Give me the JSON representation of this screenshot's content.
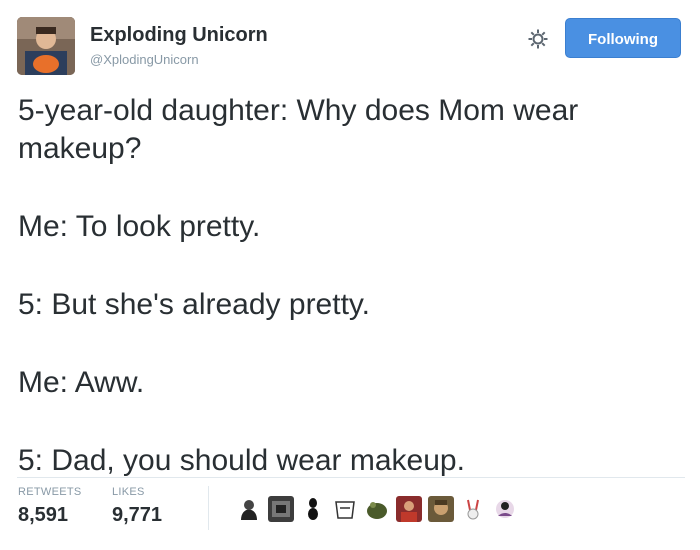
{
  "author": {
    "name": "Exploding Unicorn",
    "handle": "@XplodingUnicorn"
  },
  "icons": {
    "gear": "gear-icon",
    "avatar": "user-avatar"
  },
  "follow_button": {
    "label": "Following",
    "color": "#4a90e2"
  },
  "tweet": {
    "paragraphs": [
      "5-year-old daughter: Why does Mom wear makeup?",
      "Me: To look pretty.",
      "5: But she's already pretty.",
      "Me: Aww.",
      "5: Dad, you should wear makeup."
    ]
  },
  "stats": {
    "retweets_label": "RETWEETS",
    "retweets_value": "8,591",
    "likes_label": "LIKES",
    "likes_value": "9,771"
  },
  "likers": [
    "liker-avatar-1",
    "liker-avatar-2",
    "liker-avatar-3",
    "liker-avatar-4",
    "liker-avatar-5",
    "liker-avatar-6",
    "liker-avatar-7",
    "liker-avatar-8",
    "liker-avatar-9"
  ]
}
